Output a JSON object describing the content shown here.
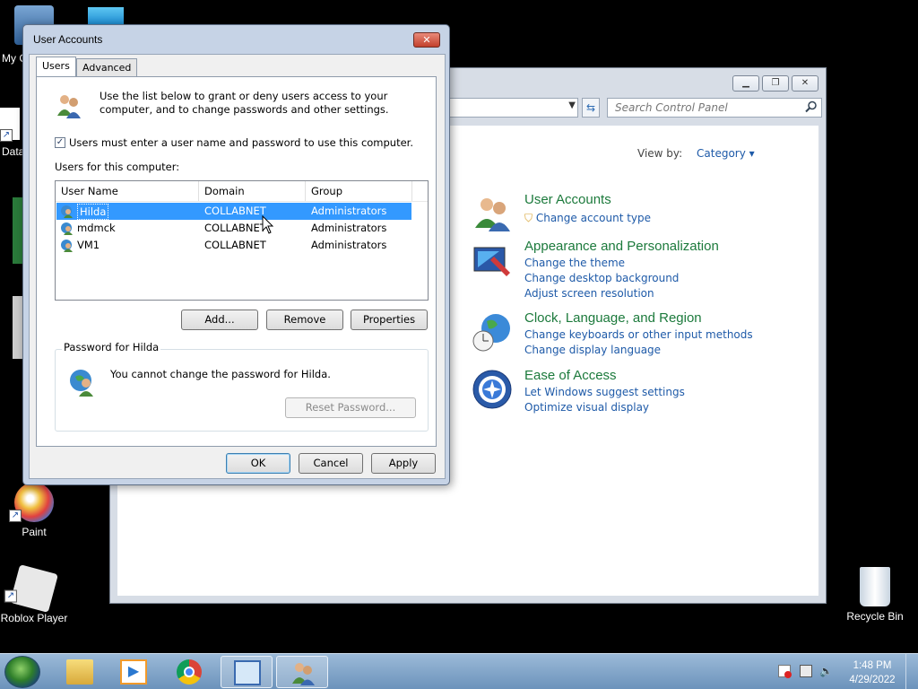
{
  "desktop": {
    "icons": [
      {
        "label": "My C"
      },
      {
        "label": "Data"
      },
      {
        "label": "Paint"
      },
      {
        "label": "Roblox Player"
      },
      {
        "label": "Recycle Bin"
      }
    ]
  },
  "control_panel": {
    "search_placeholder": "Search Control Panel",
    "view_by_label": "View by:",
    "view_by_value": "Category",
    "categories": [
      {
        "title": "User Accounts",
        "links": [
          "Change account type"
        ]
      },
      {
        "title": "Appearance and Personalization",
        "links": [
          "Change the theme",
          "Change desktop background",
          "Adjust screen resolution"
        ]
      },
      {
        "title": "Clock, Language, and Region",
        "links": [
          "Change keyboards or other input methods",
          "Change display language"
        ]
      },
      {
        "title": "Ease of Access",
        "links": [
          "Let Windows suggest settings",
          "Optimize visual display"
        ]
      }
    ]
  },
  "dialog": {
    "title": "User Accounts",
    "tabs": [
      {
        "label": "Users"
      },
      {
        "label": "Advanced"
      }
    ],
    "intro": "Use the list below to grant or deny users access to your computer, and to change passwords and other settings.",
    "checkbox_label": "Users must enter a user name and password to use this computer.",
    "checkbox_checked": true,
    "users_label": "Users for this computer:",
    "columns": [
      "User Name",
      "Domain",
      "Group"
    ],
    "users": [
      {
        "name": "Hilda",
        "domain": "COLLABNET",
        "group": "Administrators",
        "selected": true
      },
      {
        "name": "mdmck",
        "domain": "COLLABNET",
        "group": "Administrators",
        "selected": false
      },
      {
        "name": "VM1",
        "domain": "COLLABNET",
        "group": "Administrators",
        "selected": false
      }
    ],
    "buttons": {
      "add": "Add...",
      "remove": "Remove",
      "properties": "Properties"
    },
    "password_group_title": "Password for Hilda",
    "password_message": "You cannot change the password for Hilda.",
    "reset_password": "Reset Password...",
    "footer": {
      "ok": "OK",
      "cancel": "Cancel",
      "apply": "Apply"
    }
  },
  "taskbar": {
    "time": "1:48 PM",
    "date": "4/29/2022"
  },
  "colors": {
    "link": "#1e5aa8",
    "category_title": "#1c7a3c",
    "selection": "#3399ff"
  }
}
